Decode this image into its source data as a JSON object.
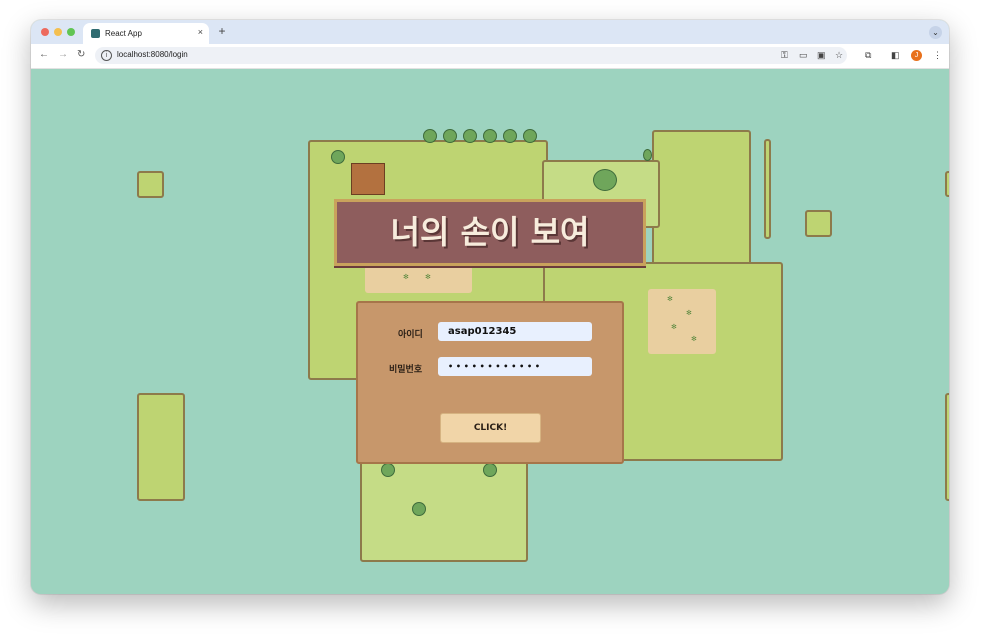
{
  "browser": {
    "tab_title": "React App",
    "tab_close": "×",
    "new_tab": "+",
    "tab_menu": "⌄",
    "url": "localhost:8080/login",
    "profile_initial": "J",
    "icons": [
      "back-icon",
      "forward-icon",
      "reload-icon",
      "site-info-icon",
      "key-icon",
      "cast-icon",
      "translate-icon",
      "bookmark-star-icon",
      "extensions-icon",
      "side-panel-icon",
      "profile-avatar",
      "more-menu-icon"
    ]
  },
  "game": {
    "title": "너의 손이 보여"
  },
  "login": {
    "id_label": "아이디",
    "id_value": "asap012345",
    "password_label": "비밀번호",
    "password_mask": "• • • • • • • • • • • •",
    "submit_label": "CLICK!"
  },
  "colors": {
    "water": "#9dd3bf",
    "grass": "#bed472",
    "banner": "#8e5d5d",
    "panel": "#c7976b",
    "button": "#f1d5a8",
    "input": "#e8f0fe"
  }
}
